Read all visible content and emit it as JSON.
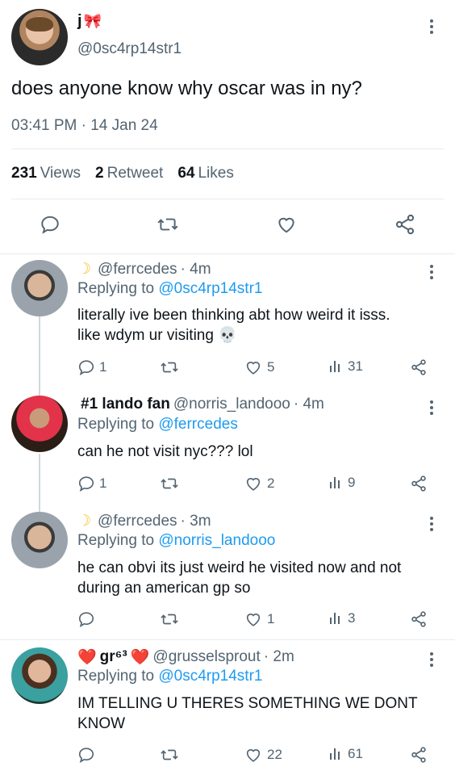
{
  "tweet": {
    "display_name": "j",
    "name_emoji": "🎀",
    "handle": "@0sc4rp14str1",
    "text": "does anyone know why oscar was in ny?",
    "timestamp": "03:41 PM · 14 Jan 24",
    "views_count": "231",
    "views_label": "Views",
    "retweets_count": "2",
    "retweets_label": "Retweet",
    "likes_count": "64",
    "likes_label": "Likes"
  },
  "replies": [
    {
      "name_emoji": "☽",
      "display_name": "",
      "handle": "@ferrcedes",
      "time": "· 4m",
      "replying_label": "Replying to",
      "replying_to": "@0sc4rp14str1",
      "text_line1": "literally ive been thinking abt how weird it isss.",
      "text_line2": "like wdym ur visiting 💀",
      "replies": "1",
      "retweets": "",
      "likes": "5",
      "views": "31"
    },
    {
      "name_emoji": "",
      "display_name": "#1 lando fan",
      "handle": "@norris_landooo",
      "time": "· 4m",
      "replying_label": "Replying to",
      "replying_to": "@ferrcedes",
      "text_line1": "can he not visit nyc??? lol",
      "text_line2": "",
      "replies": "1",
      "retweets": "",
      "likes": "2",
      "views": "9"
    },
    {
      "name_emoji": "☽",
      "display_name": "",
      "handle": "@ferrcedes",
      "time": "· 3m",
      "replying_label": "Replying to",
      "replying_to": "@norris_landooo",
      "text_line1": "he can obvi its just weird he visited now and not",
      "text_line2": "during an american gp so",
      "replies": "",
      "retweets": "",
      "likes": "1",
      "views": "3"
    },
    {
      "name_emoji": "❤️",
      "display_name": "gr⁶³",
      "name_emoji_after": "❤️",
      "handle": "@grusselsprout",
      "time": "· 2m",
      "replying_label": "Replying to",
      "replying_to": "@0sc4rp14str1",
      "text_line1": "IM TELLING U THERES SOMETHING WE DONT",
      "text_line2": "KNOW",
      "replies": "",
      "retweets": "",
      "likes": "22",
      "views": "61"
    }
  ],
  "colors": {
    "text": "#0f1419",
    "secondary": "#536471",
    "link": "#1d9bf0",
    "divider": "#e6ecf0"
  },
  "icons": [
    "more-icon",
    "reply-icon",
    "retweet-icon",
    "like-icon",
    "share-icon",
    "views-icon"
  ]
}
